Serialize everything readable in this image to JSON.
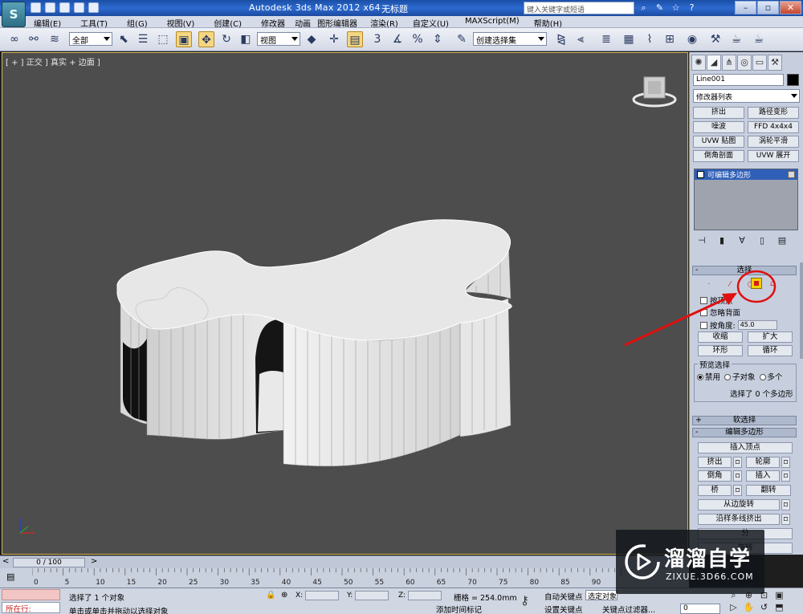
{
  "titlebar": {
    "app_title": "Autodesk 3ds Max  2012 x64",
    "document_title": "无标题",
    "search_placeholder": "键入关键字或短语",
    "logo_glyph": "S"
  },
  "menu": {
    "items": [
      "编辑(E)",
      "工具(T)",
      "组(G)",
      "视图(V)",
      "创建(C)",
      "修改器",
      "动画",
      "图形编辑器",
      "渲染(R)",
      "自定义(U)",
      "MAXScript(M)",
      "帮助(H)"
    ]
  },
  "toolbar": {
    "selection_filter": "全部",
    "reference_coord": "视图",
    "named_selection_set": "创建选择集",
    "snap_3": "3",
    "snap_percent": "%"
  },
  "viewport": {
    "label": "[ + ] 正交 ] 真实 + 边面 ]"
  },
  "command_panel": {
    "object_name": "Line001",
    "object_color": "#000000",
    "modifier_list": "修改器列表",
    "modifier_buttons": [
      "挤出",
      "路径变形",
      "噪波",
      "FFD 4x4x4",
      "UVW 贴图",
      "涡轮平滑",
      "倒角剖面",
      "UVW 展开"
    ],
    "stack_item": "可编辑多边形",
    "selection_rollout": {
      "title": "选择",
      "by_vertex": "按顶点",
      "ignore_backfacing": "忽略背面",
      "by_angle": "按角度:",
      "angle_value": "45.0",
      "shrink": "收缩",
      "grow": "扩大",
      "ring": "环形",
      "loop": "循环",
      "preview_title": "预览选择",
      "preview_options": [
        "禁用",
        "子对象",
        "多个"
      ],
      "status": "选择了 0 个多边形"
    },
    "soft_selection": "软选择",
    "edit_polygons": {
      "title": "编辑多边形",
      "insert_vertex": "插入顶点",
      "extrude": "挤出",
      "outline": "轮廓",
      "bevel": "倒角",
      "inset": "插入",
      "bridge": "桥",
      "flip": "翻转",
      "hinge": "从边旋转",
      "extrude_along_spline": "沿样条线挤出",
      "partial_1": "分",
      "partial_2": "旋转"
    }
  },
  "timeline": {
    "slider": "0 / 100",
    "ticks": [
      "0",
      "5",
      "10",
      "15",
      "20",
      "25",
      "30",
      "35",
      "40",
      "45",
      "50",
      "55",
      "60",
      "65",
      "70",
      "75",
      "80",
      "85",
      "90"
    ]
  },
  "status": {
    "running": "所在行:",
    "selected": "选择了 1 个对象",
    "prompt": "单击或单击并拖动以选择对象",
    "x_label": "X:",
    "y_label": "Y:",
    "z_label": "Z:",
    "grid": "栅格 = 254.0mm",
    "add_time_tag": "添加时间标记",
    "auto_key": "自动关键点",
    "selected_object": "选定对象",
    "set_key": "设置关键点",
    "key_filter": "关键点过滤器...",
    "frame": "0"
  },
  "watermark": {
    "title": "溜溜自学",
    "url": "ZIXUE.3D66.COM"
  }
}
